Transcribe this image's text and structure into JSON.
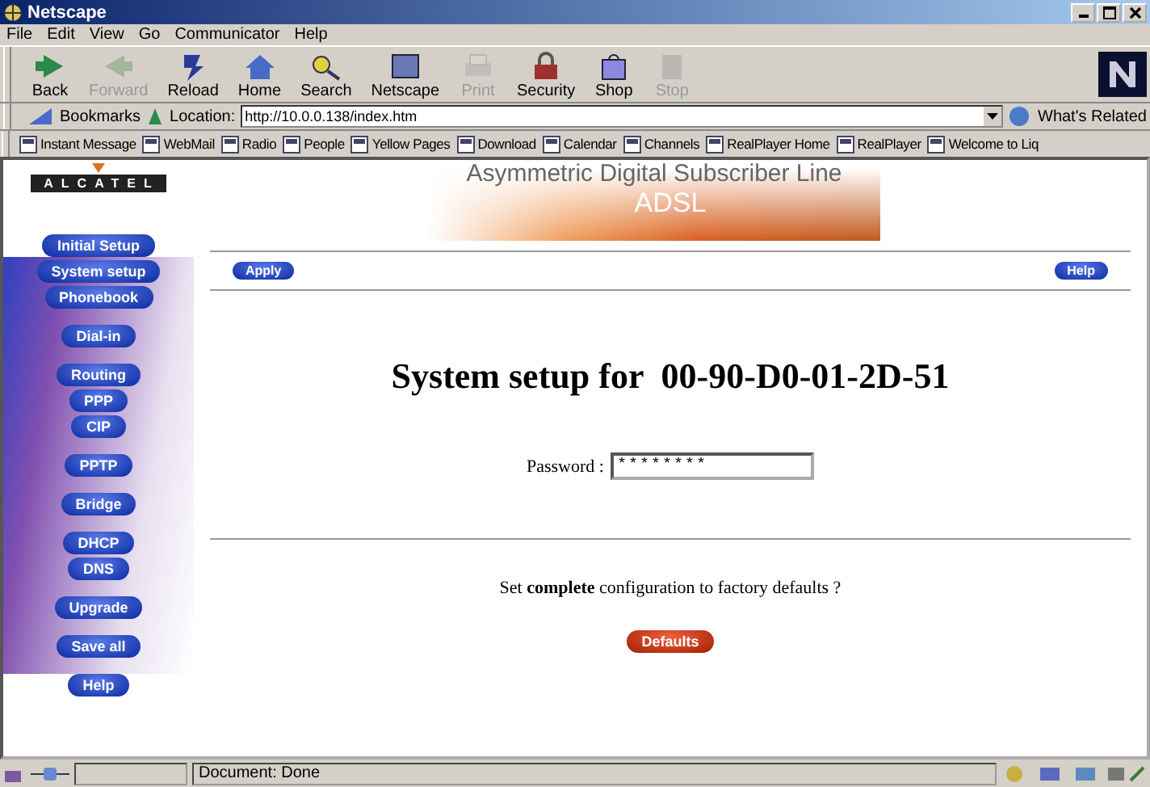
{
  "window": {
    "title": "Netscape"
  },
  "menu": [
    "File",
    "Edit",
    "View",
    "Go",
    "Communicator",
    "Help"
  ],
  "toolbar": [
    {
      "label": "Back",
      "disabled": false
    },
    {
      "label": "Forward",
      "disabled": true
    },
    {
      "label": "Reload",
      "disabled": false
    },
    {
      "label": "Home",
      "disabled": false
    },
    {
      "label": "Search",
      "disabled": false
    },
    {
      "label": "Netscape",
      "disabled": false
    },
    {
      "label": "Print",
      "disabled": true
    },
    {
      "label": "Security",
      "disabled": false
    },
    {
      "label": "Shop",
      "disabled": false
    },
    {
      "label": "Stop",
      "disabled": true
    }
  ],
  "location_bar": {
    "bookmarks": "Bookmarks",
    "location_label": "Location:",
    "url": "http://10.0.0.138/index.htm",
    "related": "What's Related"
  },
  "personal_toolbar": [
    "Instant Message",
    "WebMail",
    "Radio",
    "People",
    "Yellow Pages",
    "Download",
    "Calendar",
    "Channels",
    "RealPlayer Home",
    "RealPlayer",
    "Welcome to Liq"
  ],
  "sidebar": {
    "logo": "ALCATEL",
    "groups": [
      [
        "Initial Setup",
        "System setup",
        "Phonebook"
      ],
      [
        "Dial-in"
      ],
      [
        "Routing",
        "PPP",
        "CIP"
      ],
      [
        "PPTP"
      ],
      [
        "Bridge"
      ],
      [
        "DHCP",
        "DNS"
      ],
      [
        "Upgrade"
      ],
      [
        "Save all"
      ],
      [
        "Help"
      ]
    ]
  },
  "banner": {
    "subtitle": "Asymmetric Digital Subscriber Line",
    "title": "ADSL"
  },
  "actions": {
    "apply": "Apply",
    "help": "Help"
  },
  "heading": "System setup for  00-90-D0-01-2D-51",
  "password": {
    "label": "Password :",
    "value": "********"
  },
  "reset": {
    "text": "Set **complete** configuration to factory defaults ?",
    "button": "Defaults"
  },
  "status_bar": {
    "text": "Document: Done"
  }
}
